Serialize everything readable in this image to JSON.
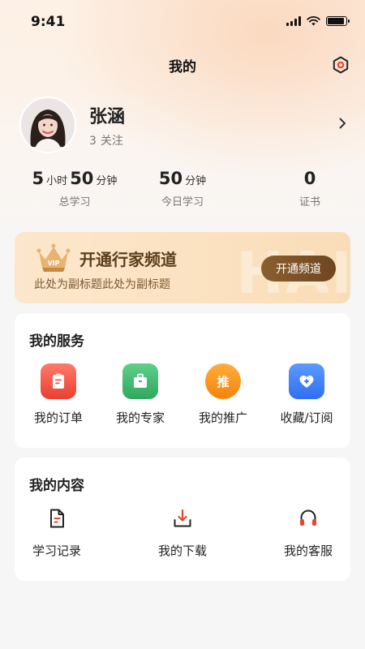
{
  "status_bar": {
    "time": "9:41",
    "battery_level": 0.9
  },
  "nav": {
    "title": "我的",
    "settings_icon": "settings-hexagon-icon"
  },
  "profile": {
    "name": "张涵",
    "follow_count": "3",
    "follow_label": "关注"
  },
  "stats": {
    "total": {
      "hours": "5",
      "hours_unit": "小时",
      "minutes": "50",
      "minutes_unit": "分钟",
      "label": "总学习"
    },
    "today": {
      "minutes": "50",
      "minutes_unit": "分钟",
      "label": "今日学习"
    },
    "certificates": {
      "value": "0",
      "label": "证书"
    }
  },
  "vip_banner": {
    "badge_text": "VIP",
    "title": "开通行家频道",
    "subtitle": "此处为副标题此处为副标题",
    "button_label": "开通频道"
  },
  "services": {
    "title": "我的服务",
    "items": [
      {
        "label": "我的订单",
        "icon": "clipboard-icon",
        "color": "#f0554a"
      },
      {
        "label": "我的专家",
        "icon": "briefcase-icon",
        "color": "#3ab96a"
      },
      {
        "label": "我的推广",
        "icon": "promote-icon",
        "icon_text": "推",
        "color": "#f68b12"
      },
      {
        "label": "收藏/订阅",
        "icon": "heart-plus-icon",
        "color": "#3b7cf0"
      }
    ]
  },
  "content": {
    "title": "我的内容",
    "items": [
      {
        "label": "学习记录",
        "icon": "document-icon"
      },
      {
        "label": "我的下载",
        "icon": "download-icon"
      },
      {
        "label": "我的客服",
        "icon": "headset-icon"
      }
    ],
    "accent_color": "#e8452c"
  }
}
